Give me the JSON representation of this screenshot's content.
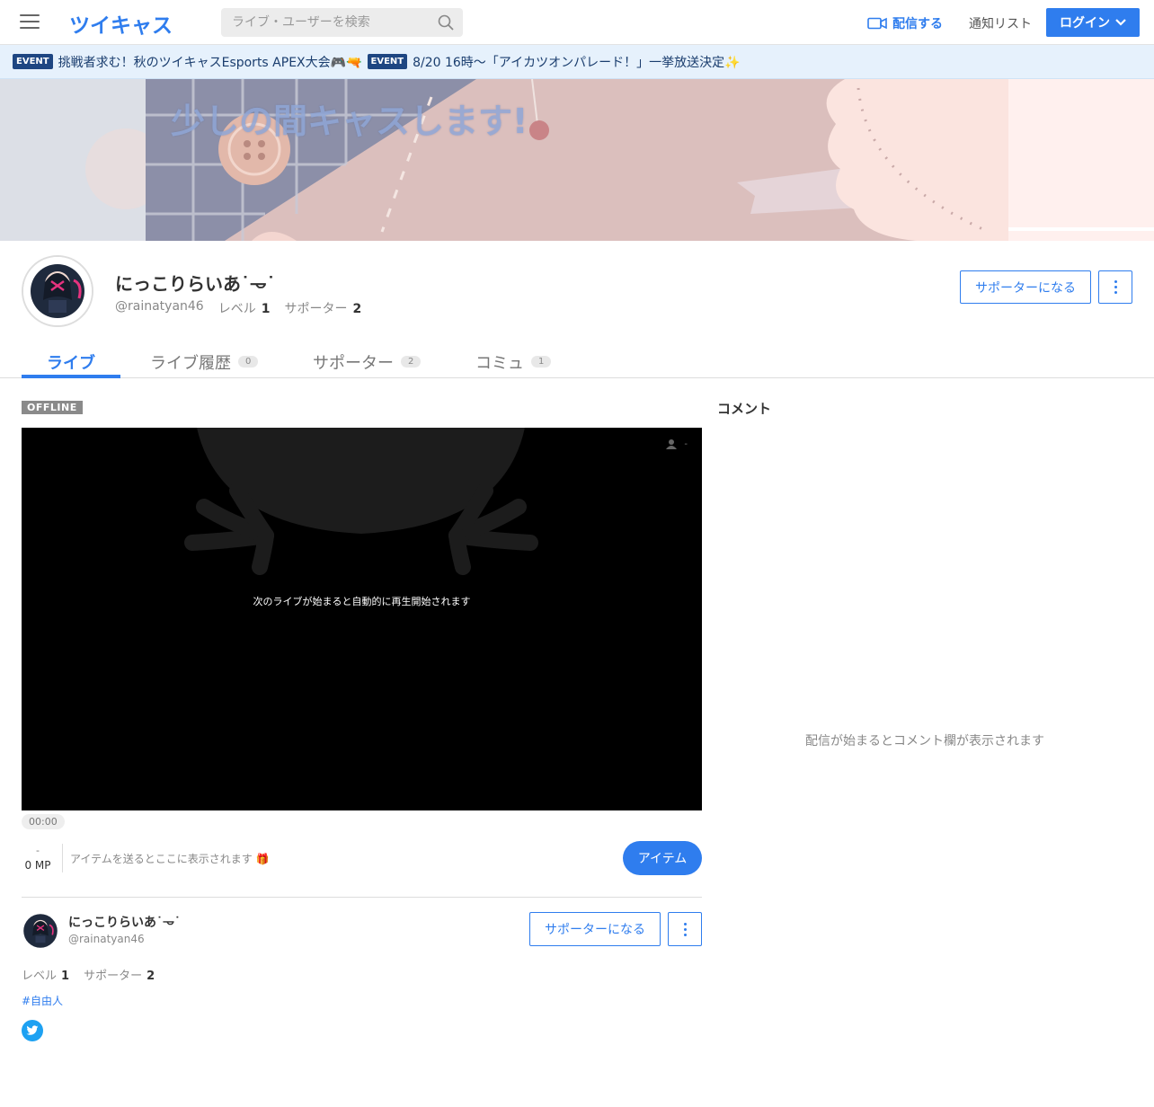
{
  "header": {
    "logo": "ツイキャス",
    "search_placeholder": "ライブ・ユーザーを検索",
    "broadcast_label": "配信する",
    "notify_label": "通知リスト",
    "login_label": "ログイン"
  },
  "events": [
    {
      "tag": "EVENT",
      "text": "挑戦者求む！秋のツイキャスEsports APEX大会🎮🔫"
    },
    {
      "tag": "EVENT",
      "text": "8/20 16時〜「アイカツオンパレード！」一挙放送決定✨"
    }
  ],
  "banner": {
    "title": "少しの間キャスします!"
  },
  "profile": {
    "name": "にっこりらいあ˙𐃷˙",
    "id": "@rainatyan46",
    "level_label": "レベル",
    "level": "1",
    "supporter_label": "サポーター",
    "supporters": "2",
    "support_button": "サポーターになる"
  },
  "tabs": [
    {
      "label": "ライブ",
      "count": null
    },
    {
      "label": "ライブ履歴",
      "count": "0"
    },
    {
      "label": "サポーター",
      "count": "2"
    },
    {
      "label": "コミュ",
      "count": "1"
    }
  ],
  "player": {
    "status": "OFFLINE",
    "message": "次のライブが始まると自動的に再生開始されます",
    "viewers": "-",
    "time": "00:00"
  },
  "items": {
    "mp_dash": "-",
    "mp": "0 MP",
    "placeholder": "アイテムを送るとここに表示されます 🎁",
    "button": "アイテム"
  },
  "profile_card": {
    "name": "にっこりらいあ˙𐃷˙",
    "id": "@rainatyan46",
    "level_label": "レベル",
    "level": "1",
    "supporter_label": "サポーター",
    "supporters": "2",
    "support_button": "サポーターになる",
    "hashtag": "#自由人"
  },
  "comments": {
    "title": "コメント",
    "empty": "配信が始まるとコメント欄が表示されます"
  },
  "colors": {
    "accent": "#2f7dee",
    "event_bg": "#e6f1fc",
    "event_tag": "#1e4682",
    "twitter": "#1da1f2"
  }
}
